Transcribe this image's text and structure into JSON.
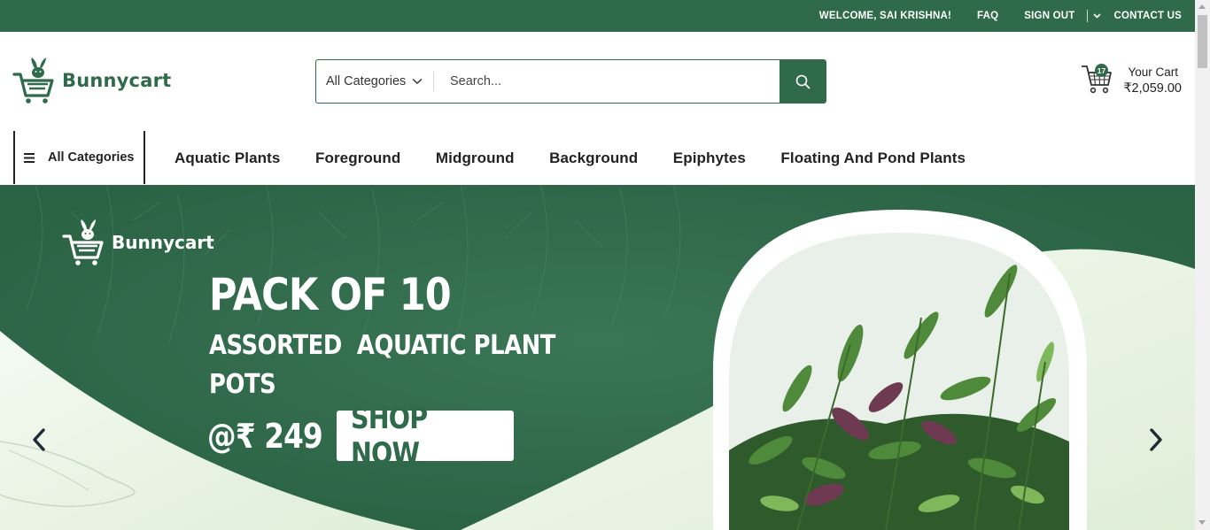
{
  "topbar": {
    "welcome": "WELCOME, SAI KRISHNA!",
    "faq": "FAQ",
    "sign_out": "SIGN OUT",
    "contact": "CONTACT US"
  },
  "header": {
    "logo_text": "Bunnycart",
    "search": {
      "category": "All Categories",
      "placeholder": "Search..."
    },
    "cart": {
      "label": "Your Cart",
      "count": "17",
      "total": "₹2,059.00"
    }
  },
  "nav": {
    "all_categories": "All Categories",
    "links": [
      "Aquatic Plants",
      "Foreground",
      "Midground",
      "Background",
      "Epiphytes",
      "Floating And Pond Plants"
    ]
  },
  "banner": {
    "logo_text": "Bunnycart",
    "title": "PACK OF 10",
    "subtitle_line1": "ASSORTED  AQUATIC PLANT",
    "subtitle_line2": "POTS",
    "price": "@₹ 249",
    "cta": "SHOP NOW"
  },
  "colors": {
    "brand_green": "#2f6a4b",
    "banner_green": "#2d6848",
    "light_green": "#eef6ea"
  },
  "icons": [
    "bunny-cart-logo-icon",
    "chevron-down-icon",
    "search-icon",
    "cart-icon",
    "hamburger-icon",
    "chevron-left-icon",
    "chevron-right-icon"
  ]
}
